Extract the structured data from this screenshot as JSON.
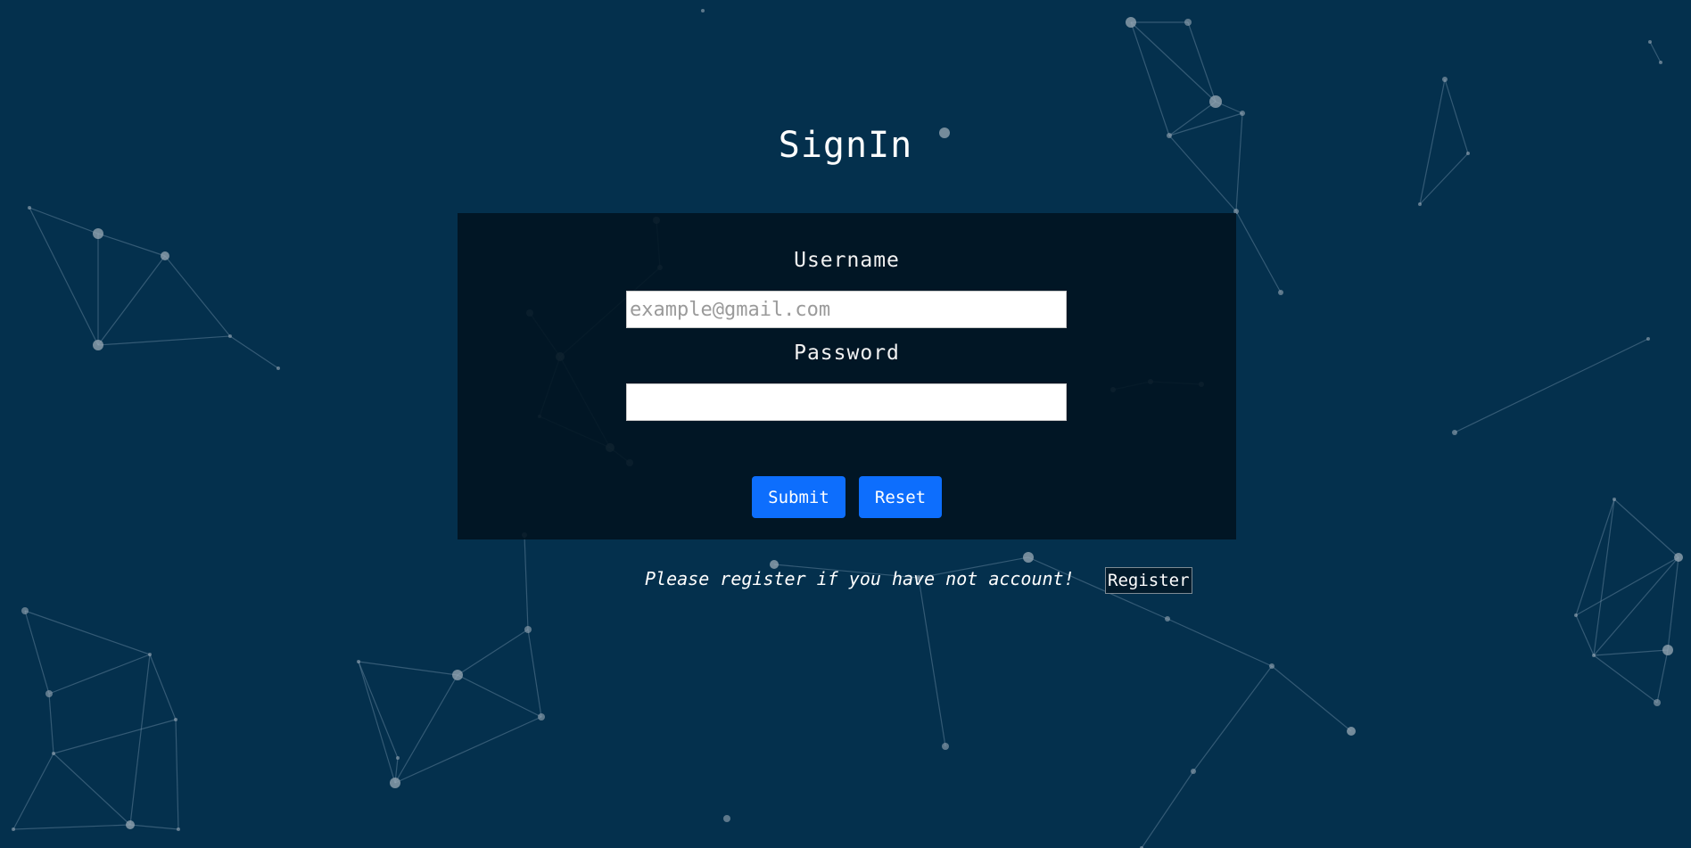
{
  "page": {
    "title": "SignIn",
    "background_color": "#04304d",
    "panel_color": "#011421"
  },
  "form": {
    "username_label": "Username",
    "username_placeholder": "example@gmail.com",
    "username_value": "",
    "password_label": "Password",
    "password_value": "",
    "submit_label": "Submit",
    "reset_label": "Reset",
    "button_color": "#0d6efd"
  },
  "register": {
    "prompt": "Please register if you have not account!",
    "button_label": "Register"
  },
  "background": {
    "type": "particle-network"
  }
}
